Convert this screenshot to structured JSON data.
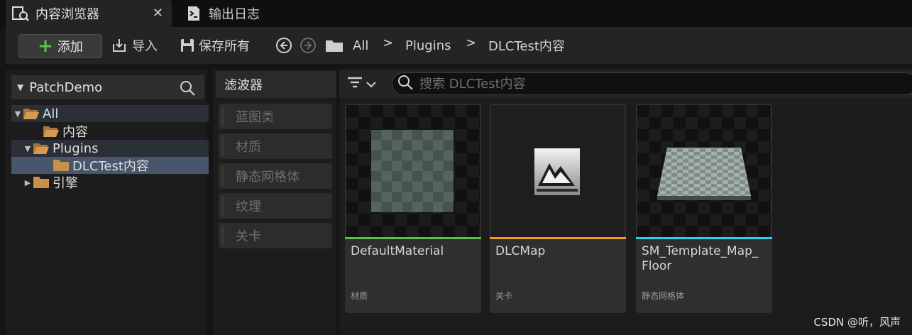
{
  "tabs": [
    {
      "label": "内容浏览器",
      "icon": "content-browser-icon",
      "active": true
    },
    {
      "label": "输出日志",
      "icon": "output-log-icon",
      "active": false
    }
  ],
  "toolbar": {
    "add_label": "添加",
    "import_label": "导入",
    "save_all_label": "保存所有",
    "breadcrumb": [
      "All",
      "Plugins",
      "DLCTest内容"
    ]
  },
  "tree": {
    "root_label": "PatchDemo",
    "items": [
      {
        "label": "All",
        "depth": 0,
        "expanded": true
      },
      {
        "label": "内容",
        "depth": 1
      },
      {
        "label": "Plugins",
        "depth": 1,
        "expanded": true
      },
      {
        "label": "DLCTest内容",
        "depth": 2,
        "selected": true
      },
      {
        "label": "引擎",
        "depth": 1,
        "expanded": false
      }
    ]
  },
  "filters": {
    "title": "滤波器",
    "items": [
      "蓝图类",
      "材质",
      "静态网格体",
      "纹理",
      "关卡"
    ]
  },
  "search": {
    "placeholder": "搜索 DLCTest内容"
  },
  "assets": [
    {
      "name": "DefaultMaterial",
      "type": "材质",
      "color": "#57c04a"
    },
    {
      "name": "DLCMap",
      "type": "关卡",
      "color": "#f39a1b"
    },
    {
      "name": "SM_Template_Map_\nFloor",
      "type": "静态网格体",
      "color": "#27d3e6"
    }
  ],
  "watermark": "CSDN @听，风声",
  "colors": {
    "accent_green": "#5cc04a",
    "folder": "#c9904a"
  }
}
